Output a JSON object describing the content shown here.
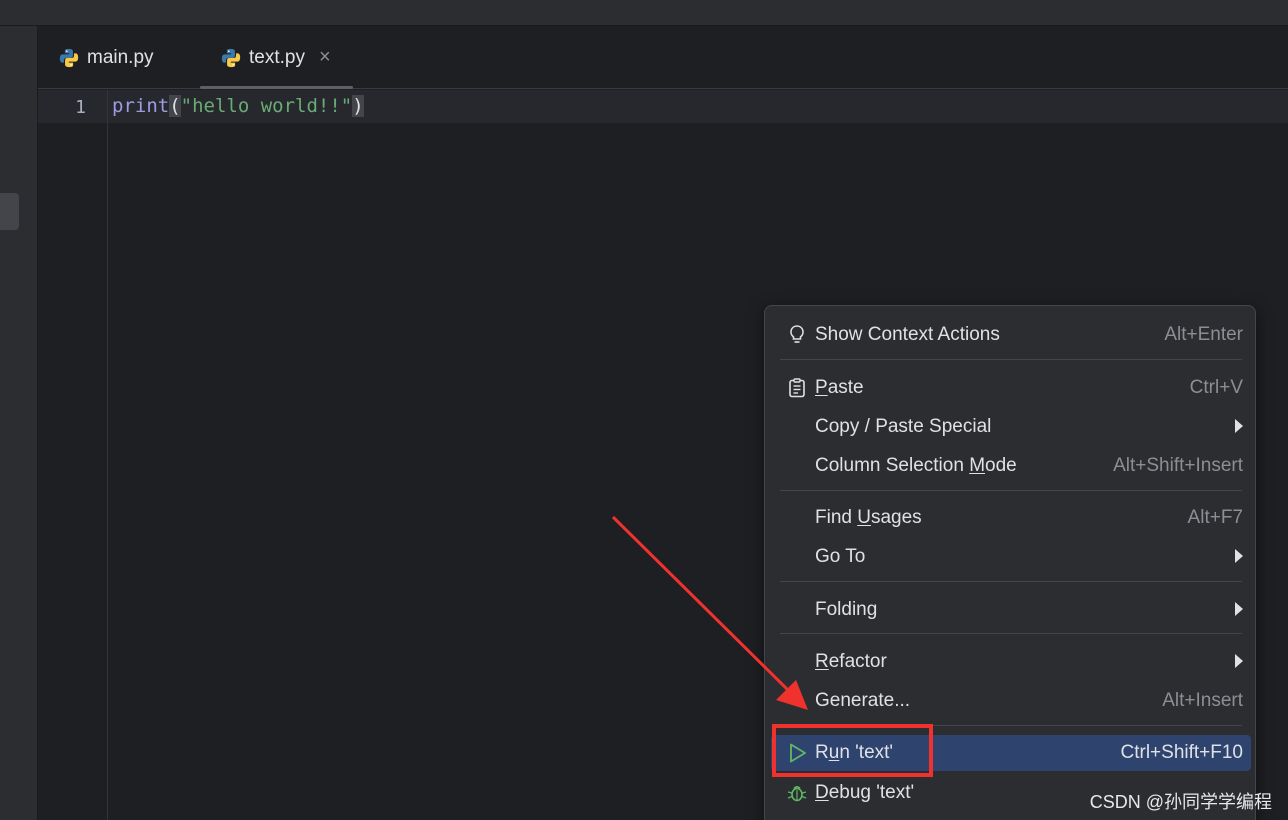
{
  "tabs": [
    {
      "label": "main.py",
      "active": false
    },
    {
      "label": "text.py",
      "active": true,
      "close_glyph": "×"
    }
  ],
  "editor": {
    "line_number": "1",
    "code": {
      "fn": "print",
      "open": "(",
      "str": "\"hello world!!\"",
      "close": ")"
    }
  },
  "context_menu": {
    "items": [
      {
        "label": "Show Context Actions",
        "shortcut": "Alt+Enter",
        "icon": "lightbulb-icon"
      },
      {
        "label_pre": "",
        "label_u": "P",
        "label_post": "aste",
        "shortcut": "Ctrl+V",
        "icon": "clipboard-icon"
      },
      {
        "label": "Copy / Paste Special",
        "submenu": true
      },
      {
        "label_pre": "Column Selection ",
        "label_u": "M",
        "label_post": "ode",
        "shortcut": "Alt+Shift+Insert"
      },
      {
        "label_pre": "Find ",
        "label_u": "U",
        "label_post": "sages",
        "shortcut": "Alt+F7"
      },
      {
        "label": "Go To",
        "submenu": true
      },
      {
        "label": "Folding",
        "submenu": true
      },
      {
        "label_pre": "",
        "label_u": "R",
        "label_post": "efactor",
        "submenu": true
      },
      {
        "label": "Generate...",
        "shortcut": "Alt+Insert"
      },
      {
        "label_pre": "R",
        "label_u": "u",
        "label_post": "n 'text'",
        "shortcut": "Ctrl+Shift+F10",
        "icon": "run-icon",
        "selected": true
      },
      {
        "label_pre": "",
        "label_u": "D",
        "label_post": "ebug 'text'",
        "icon": "debug-bug-icon"
      }
    ]
  },
  "annotation": {
    "color": "#f0322f"
  },
  "colors": {
    "accent_selection": "#2e436e",
    "run_green": "#5fb865"
  },
  "watermark": "CSDN @孙同学学编程"
}
